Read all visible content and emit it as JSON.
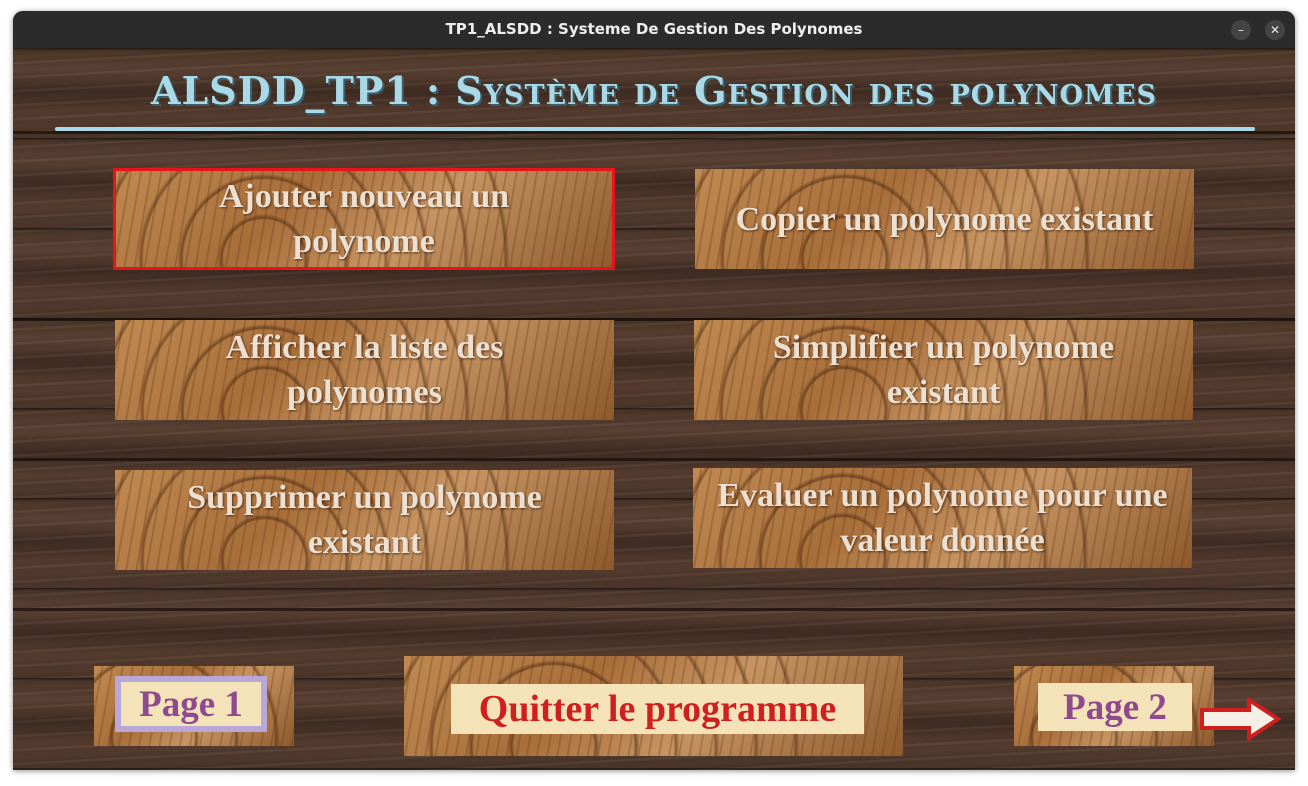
{
  "window": {
    "title": "TP1_ALSDD : Systeme De Gestion Des Polynomes",
    "minimize_glyph": "–",
    "close_glyph": "✕"
  },
  "heading": "ALSDD_TP1 : Système de Gestion des polynomes",
  "menu": {
    "add": "Ajouter nouveau un polynome",
    "copy": "Copier un polynome existant",
    "list": "Afficher la liste des polynomes",
    "simplify": "Simplifier un polynome existant",
    "delete": "Supprimer un polynome existant",
    "evaluate": "Evaluer un polynome pour une valeur donnée"
  },
  "footer": {
    "page1": "Page 1",
    "quit": "Quitter le programme",
    "page2": "Page 2",
    "next_icon": "arrow-right-icon"
  },
  "colors": {
    "heading": "#a9d9e6",
    "selection_border": "#e8141a",
    "page_label_text": "#8e4a8f",
    "quit_text": "#d01f1f",
    "label_background": "#f4e3b8"
  }
}
